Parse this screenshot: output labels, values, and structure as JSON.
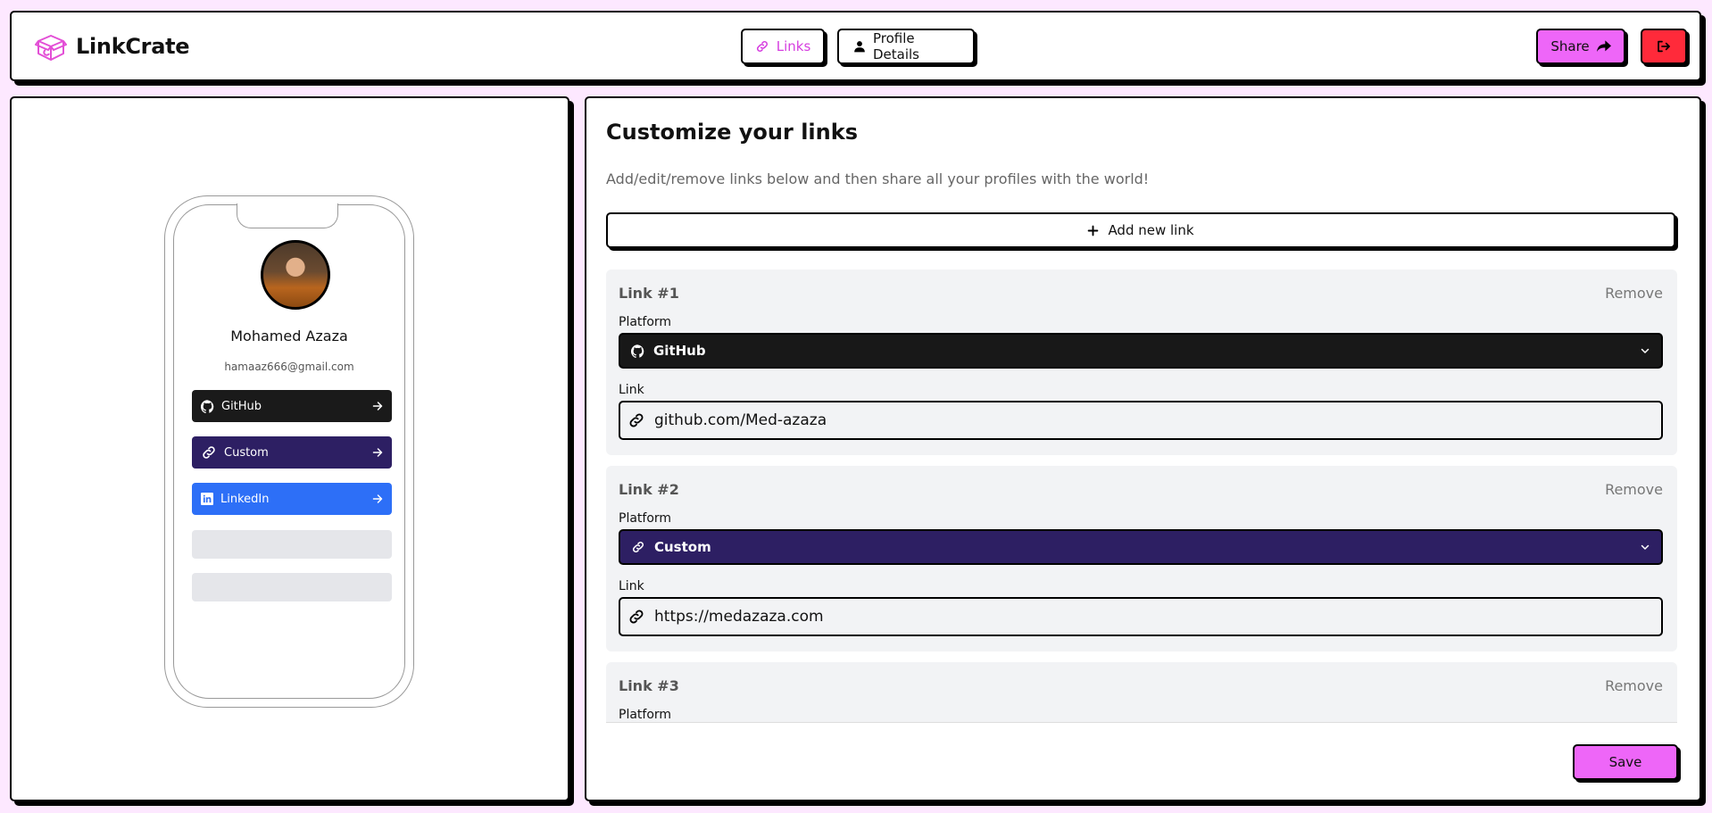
{
  "app": {
    "name": "LinkCrate"
  },
  "nav": {
    "links_label": "Links",
    "profile_label": "Profile Details",
    "share_label": "Share"
  },
  "preview": {
    "name": "Mohamed Azaza",
    "email": "hamaaz666@gmail.com",
    "links": [
      {
        "label": "GitHub",
        "color": "#1a1a1a",
        "icon": "github-icon"
      },
      {
        "label": "Custom",
        "color": "#2d1f63",
        "icon": "link-icon"
      },
      {
        "label": "LinkedIn",
        "color": "#2d6ff7",
        "icon": "linkedin-icon"
      }
    ]
  },
  "editor": {
    "title": "Customize your links",
    "subtitle": "Add/edit/remove links below and then share all your profiles with the world!",
    "add_label": "Add new link",
    "platform_label": "Platform",
    "link_label": "Link",
    "remove_label": "Remove",
    "save_label": "Save",
    "links": [
      {
        "title": "Link #1",
        "platform": "GitHub",
        "color": "#181818",
        "icon": "github-icon",
        "url": "github.com/Med-azaza"
      },
      {
        "title": "Link #2",
        "platform": "Custom",
        "color": "#2d1f63",
        "icon": "link-icon",
        "url": "https://medazaza.com"
      },
      {
        "title": "Link #3"
      }
    ]
  }
}
